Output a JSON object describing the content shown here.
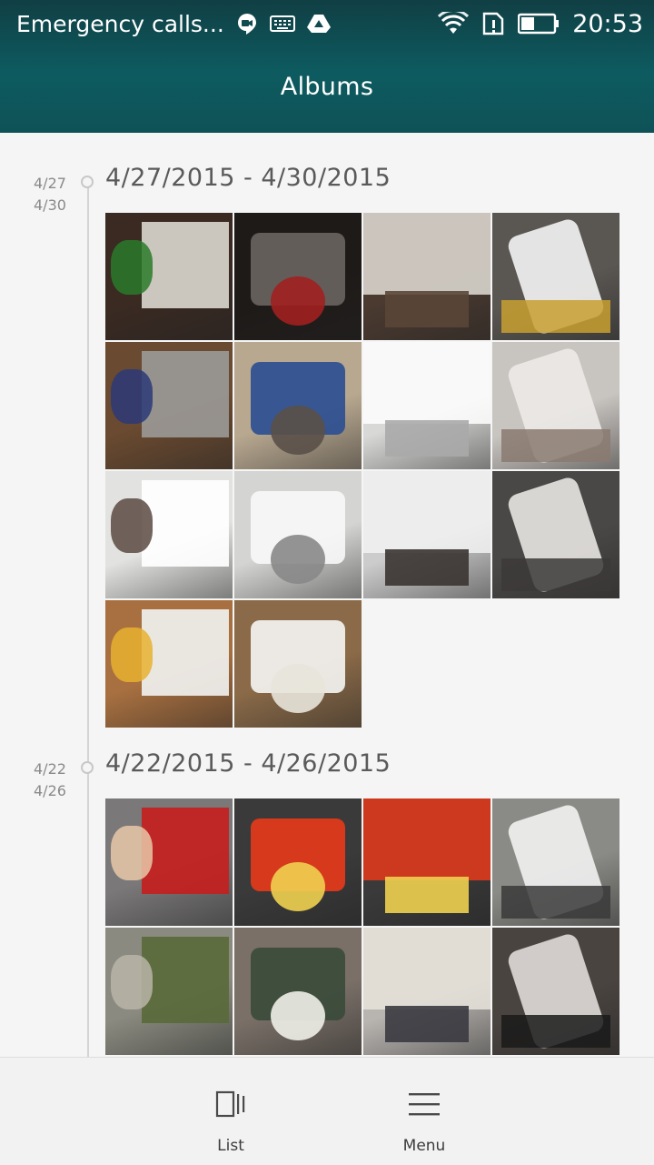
{
  "status_bar": {
    "carrier_text": "Emergency calls...",
    "time": "20:53",
    "icons": [
      "hangouts-icon",
      "keyboard-icon",
      "drive-icon",
      "wifi-icon",
      "sim-alert-icon",
      "battery-icon"
    ]
  },
  "header": {
    "title": "Albums"
  },
  "groups": [
    {
      "start_short": "4/27",
      "end_short": "4/30",
      "title": "4/27/2015 - 4/30/2015",
      "photos": [
        {
          "bg": "#3a2a22",
          "a": "#d8d4cc",
          "b": "#2a7a2a"
        },
        {
          "bg": "#1e1a18",
          "a": "#6a6560",
          "b": "#a02020"
        },
        {
          "bg": "#4a3a30",
          "a": "#e2ded6",
          "b": "#5a4638"
        },
        {
          "bg": "#5a5652",
          "a": "#f4f4f4",
          "b": "#c8a030"
        },
        {
          "bg": "#6a4a30",
          "a": "#9a9896",
          "b": "#2c3a78"
        },
        {
          "bg": "#b8a890",
          "a": "#2a4e92",
          "b": "#5a5048"
        },
        {
          "bg": "#d8d8d6",
          "a": "#ffffff",
          "b": "#a8aaa8"
        },
        {
          "bg": "#c8c4c0",
          "a": "#eceae8",
          "b": "#8a7a70"
        },
        {
          "bg": "#e2e2e0",
          "a": "#ffffff",
          "b": "#5a4a42"
        },
        {
          "bg": "#d4d4d2",
          "a": "#f8f8f8",
          "b": "#8a8888"
        },
        {
          "bg": "#cccccc",
          "a": "#f2f2f2",
          "b": "#3a3432"
        },
        {
          "bg": "#4a4846",
          "a": "#e8e6e2",
          "b": "#3c3a38"
        },
        {
          "bg": "#a87040",
          "a": "#f0f0ee",
          "b": "#e8b030"
        },
        {
          "bg": "#8a6a48",
          "a": "#f6f6f4",
          "b": "#e8e4da"
        }
      ]
    },
    {
      "start_short": "4/22",
      "end_short": "4/26",
      "title": "4/22/2015 - 4/26/2015",
      "photos": [
        {
          "bg": "#7a7878",
          "a": "#c42020",
          "b": "#e8c8a8"
        },
        {
          "bg": "#3a3a3a",
          "a": "#e83a1a",
          "b": "#f0d050"
        },
        {
          "bg": "#3a3a3a",
          "a": "#e83a1a",
          "b": "#f0d050"
        },
        {
          "bg": "#8a8a86",
          "a": "#f2f2f2",
          "b": "#3a3a3a"
        },
        {
          "bg": "#8a8a80",
          "a": "#5a6a3a",
          "b": "#b8b4a8"
        },
        {
          "bg": "#7a7068",
          "a": "#3a4a3a",
          "b": "#f0f0e8"
        },
        {
          "bg": "#b8b4b0",
          "a": "#e8e4dc",
          "b": "#3a3a40"
        },
        {
          "bg": "#4a4440",
          "a": "#e0dcd8",
          "b": "#1a1a1a"
        }
      ]
    }
  ],
  "bottom_bar": {
    "list_label": "List",
    "menu_label": "Menu"
  }
}
